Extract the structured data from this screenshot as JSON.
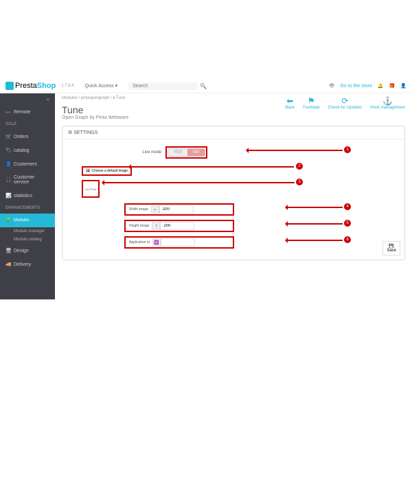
{
  "top": {
    "logo": "Presta",
    "logo2": "Shop",
    "ver": "1.7.8.4",
    "qa": "Quick Access",
    "search": "Search",
    "store": "Go to the store"
  },
  "side": {
    "remote": "Remote",
    "sale": "SALE",
    "orders": "Orders",
    "catalog": "catalog",
    "customers": "Customers",
    "cs": "Customer service",
    "stats": "statistics",
    "enh": "ENHANCEMENTS",
    "modules": "Modules",
    "mm": "Module manager",
    "mc": "Module catalog",
    "design": "Design",
    "delivery": "Delivery"
  },
  "bc": "Modules / pintaopengraph / ♦ Tune",
  "h1": "Tune",
  "sub": "Open Graph by Pinta Webware",
  "acts": {
    "back": "Back",
    "tr": "Translate",
    "cu": "Check for Updates",
    "hm": "Hook management"
  },
  "panel": {
    "title": "SETTINGS",
    "live": "Live mode",
    "yes": "YES",
    "no": "NO",
    "choose": "Choose a default image",
    "img": "my-Pinta",
    "width": "Width image",
    "height": "Height image",
    "appid": "Application id",
    "v200": "200",
    "save": "Save"
  },
  "n": {
    "1": "1",
    "2": "2",
    "3": "3",
    "4": "4",
    "5": "5",
    "6": "6"
  }
}
